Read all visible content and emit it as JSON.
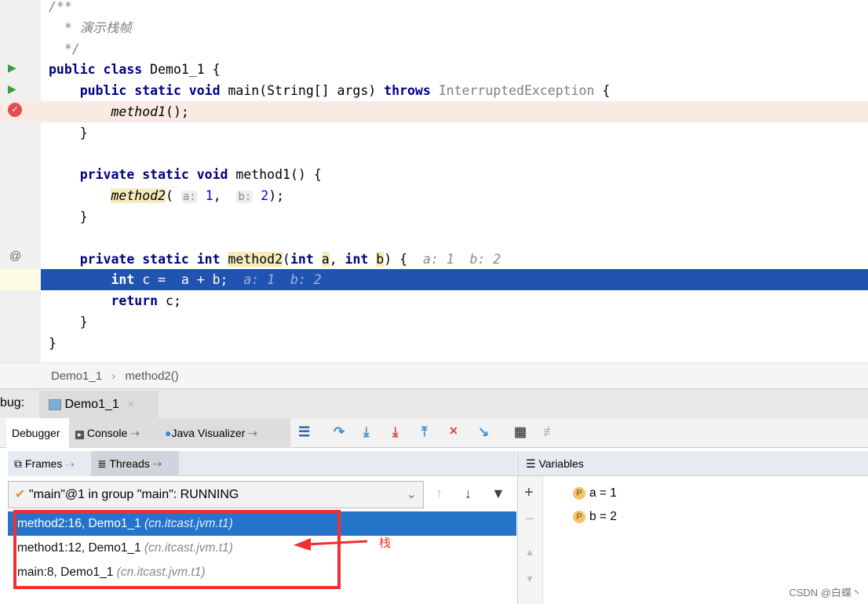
{
  "editor": {
    "lines": [
      [
        {
          "t": "/**",
          "c": "cm"
        }
      ],
      [
        {
          "t": "  * 演示栈帧",
          "c": "cm"
        }
      ],
      [
        {
          "t": "  */",
          "c": "cm"
        }
      ],
      [
        {
          "t": "public class ",
          "c": "kw"
        },
        {
          "t": "Demo1_1 {",
          "c": ""
        }
      ],
      [
        {
          "t": "    public static void ",
          "c": "kw"
        },
        {
          "t": "main(String[] args) ",
          "c": ""
        },
        {
          "t": "throws ",
          "c": "kw"
        },
        {
          "t": "InterruptedException",
          "c": "gr"
        },
        {
          "t": " {",
          "c": ""
        }
      ],
      [
        {
          "t": "        ",
          "c": ""
        },
        {
          "t": "method1",
          "c": "it"
        },
        {
          "t": "();",
          "c": ""
        }
      ],
      [
        {
          "t": "    }",
          "c": ""
        }
      ],
      [
        {
          "t": "",
          "c": ""
        }
      ],
      [
        {
          "t": "    private static void ",
          "c": "kw"
        },
        {
          "t": "method1() {",
          "c": ""
        }
      ],
      [
        {
          "t": "        ",
          "c": ""
        },
        {
          "t": "method2",
          "c": "it hl"
        },
        {
          "t": "( ",
          "c": ""
        },
        {
          "t": "a:",
          "c": "hint"
        },
        {
          "t": " 1",
          "c": "num"
        },
        {
          "t": ",  ",
          "c": ""
        },
        {
          "t": "b:",
          "c": "hint"
        },
        {
          "t": " 2",
          "c": "num"
        },
        {
          "t": ");",
          "c": ""
        }
      ],
      [
        {
          "t": "    }",
          "c": ""
        }
      ],
      [
        {
          "t": "",
          "c": ""
        }
      ],
      [
        {
          "t": "    private static int ",
          "c": "kw"
        },
        {
          "t": "method2",
          "c": "hl"
        },
        {
          "t": "(",
          "c": ""
        },
        {
          "t": "int ",
          "c": "kw"
        },
        {
          "t": "a",
          "c": "hl"
        },
        {
          "t": ", ",
          "c": ""
        },
        {
          "t": "int ",
          "c": "kw"
        },
        {
          "t": "b",
          "c": "hl"
        },
        {
          "t": ") {  ",
          "c": ""
        },
        {
          "t": "a: 1  b: 2",
          "c": "inl"
        }
      ],
      [
        {
          "t": "        int ",
          "c": "kw"
        },
        {
          "t": "c =  a + b;  ",
          "c": ""
        },
        {
          "t": "a: 1  b: 2",
          "c": "inl"
        }
      ],
      [
        {
          "t": "        return ",
          "c": "kw"
        },
        {
          "t": "c;",
          "c": ""
        }
      ],
      [
        {
          "t": "    }",
          "c": ""
        }
      ],
      [
        {
          "t": "}",
          "c": ""
        }
      ]
    ],
    "breakpoint_line": 5,
    "current_line": 13
  },
  "breadcrumb": [
    "Demo1_1",
    "method2()"
  ],
  "debug": {
    "label": "bug:",
    "session_tab": "Demo1_1",
    "tabs": [
      "Debugger",
      "Console",
      "Java Visualizer"
    ],
    "frames_tab": "Frames",
    "threads_tab": "Threads",
    "variables_title": "Variables",
    "thread_select": "\"main\"@1 in group \"main\": RUNNING",
    "frames": [
      {
        "name": "method2:16, Demo1_1 ",
        "pkg": "(cn.itcast.jvm.t1)"
      },
      {
        "name": "method1:12, Demo1_1 ",
        "pkg": "(cn.itcast.jvm.t1)"
      },
      {
        "name": "main:8, Demo1_1 ",
        "pkg": "(cn.itcast.jvm.t1)"
      }
    ],
    "variables": [
      "a = 1",
      "b = 2"
    ]
  },
  "annotation": {
    "label": "栈",
    "color": "#f03030"
  },
  "watermark": "CSDN @白蝶丶"
}
